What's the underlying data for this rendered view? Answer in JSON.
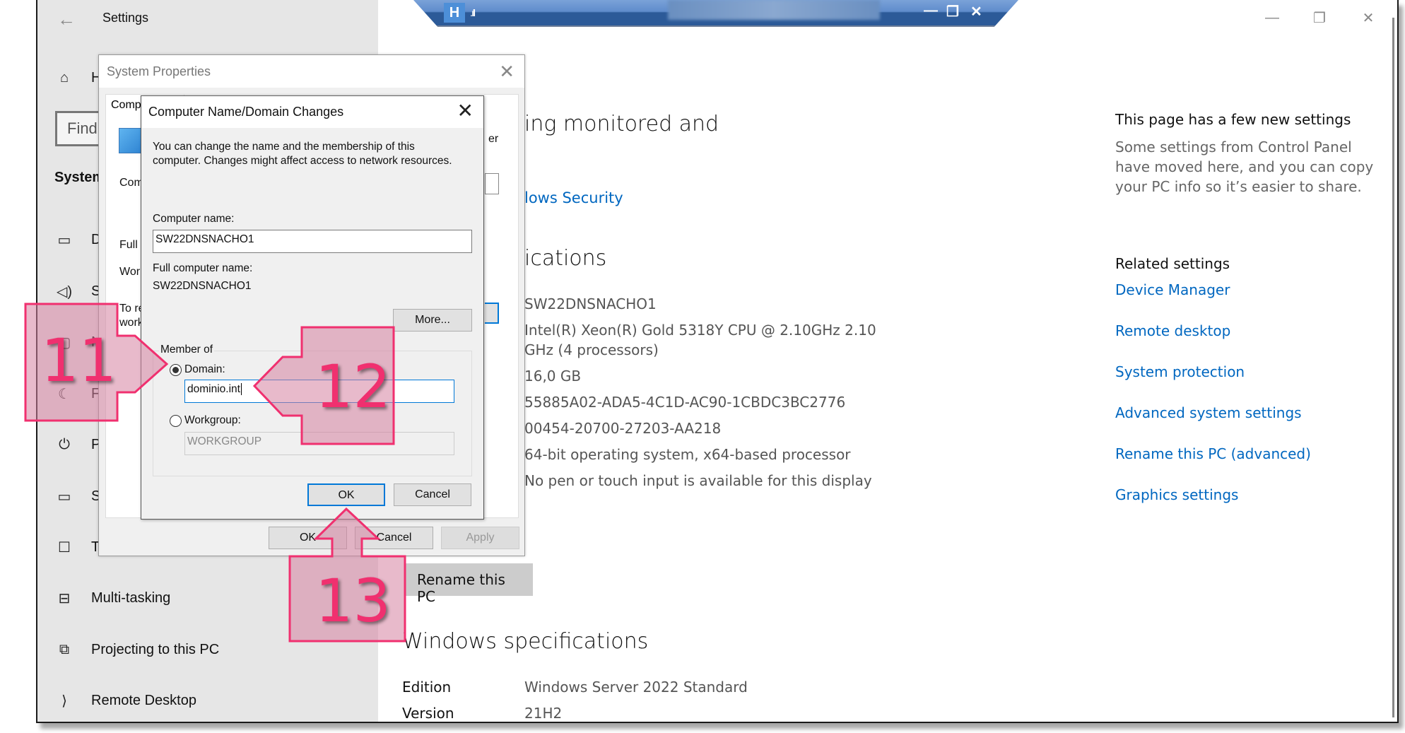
{
  "window": {
    "title": "Settings",
    "back_icon": "←",
    "controls": {
      "minimize": "—",
      "maximize": "❐",
      "close": "✕"
    }
  },
  "sidebar": {
    "home_label": "H",
    "find_placeholder": "Find",
    "section_title": "System",
    "items": [
      {
        "icon": "display-icon",
        "glyph": "▭",
        "label": "Di"
      },
      {
        "icon": "sound-icon",
        "glyph": "🔈",
        "label": "So"
      },
      {
        "icon": "notifications-icon",
        "glyph": "▢",
        "label": "N"
      },
      {
        "icon": "focus-assist-icon",
        "glyph": "☾",
        "label": "Fo"
      },
      {
        "icon": "power-icon",
        "glyph": "⏻",
        "label": "Po"
      },
      {
        "icon": "storage-icon",
        "glyph": "▭",
        "label": "St"
      },
      {
        "icon": "tablet-icon",
        "glyph": "☐",
        "label": "Ta"
      },
      {
        "icon": "multitasking-icon",
        "glyph": "⊟",
        "label": "Multi-tasking"
      },
      {
        "icon": "projecting-icon",
        "glyph": "⧉",
        "label": "Projecting to this PC"
      },
      {
        "icon": "remote-desktop-icon",
        "glyph": "⟩",
        "label": "Remote Desktop"
      }
    ]
  },
  "remote_bar": {
    "pin_icon": "H",
    "signal_icon": ".ıll",
    "controls": {
      "minimize": "—",
      "restore": "❐",
      "close": "✕"
    }
  },
  "main": {
    "heading_fragment": "ing monitored and",
    "security_link_fragment": "lows Security",
    "device_specs_fragment": "ications",
    "specs": [
      "SW22DNSNACHO1",
      "Intel(R) Xeon(R) Gold 5318Y CPU @ 2.10GHz   2.10",
      "GHz  (4 processors)",
      "16,0 GB",
      "55885A02-ADA5-4C1D-AC90-1CBDC3BC2776",
      "00454-20700-27203-AA218",
      "64-bit operating system, x64-based processor",
      "No pen or touch input is available for this display"
    ],
    "rename_button": "Rename this PC",
    "windows_specs_heading": "Windows specifications",
    "windows_specs": [
      {
        "label": "Edition",
        "value": "Windows Server 2022 Standard"
      },
      {
        "label": "Version",
        "value": "21H2"
      }
    ]
  },
  "right_panel": {
    "new_settings_title": "This page has a few new settings",
    "new_settings_desc": [
      "Some settings from Control Panel",
      "have moved here, and you can copy",
      "your PC info so it’s easier to share."
    ],
    "related_title": "Related settings",
    "related_links": [
      "Device Manager",
      "Remote desktop",
      "System protection",
      "Advanced system settings",
      "Rename this PC (advanced)",
      "Graphics settings"
    ]
  },
  "system_properties": {
    "title": "System Properties",
    "tab_fragment": "Comp",
    "fragments": {
      "com": "Com",
      "full": "Full c",
      "work": "Work",
      "tore": "To re",
      "work2": "work",
      "er": "er"
    },
    "buttons": {
      "ok": "OK",
      "cancel": "Cancel",
      "apply": "Apply"
    }
  },
  "domain_dialog": {
    "title": "Computer Name/Domain Changes",
    "description": [
      "You can change the name and the membership of this",
      "computer. Changes might affect access to network resources."
    ],
    "computer_name_label": "Computer name:",
    "computer_name_value": "SW22DNSNACHO1",
    "full_name_label": "Full computer name:",
    "full_name_value": "SW22DNSNACHO1",
    "more_button": "More...",
    "member_of_label": "Member of",
    "domain_label": "Domain:",
    "domain_value": "dominio.int",
    "domain_selected": true,
    "workgroup_label": "Workgroup:",
    "workgroup_value": "WORKGROUP",
    "ok_button": "OK",
    "cancel_button": "Cancel"
  },
  "annotations": {
    "step_11": "11",
    "step_12": "12",
    "step_13": "13",
    "color": "#f0306f"
  }
}
